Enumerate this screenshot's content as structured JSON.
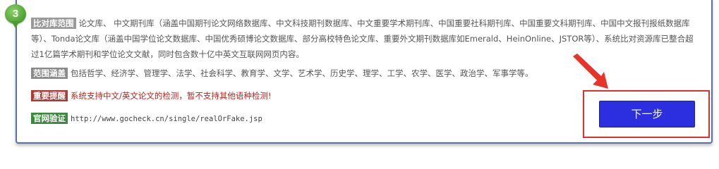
{
  "step": {
    "number": "3"
  },
  "scope": {
    "tag": "比对库范围",
    "text": "论文库、 中文期刊库（涵盖中国期刊论文网络数据库、中文科技期刊数据库、中文重要学术期刊库、中国重要社科期刊库、中国重要文科期刊库、中国中文报刊报纸数据库等）、Tonda论文库（涵盖中国学位论文数据库、中国优秀硕博论文数据库、部分高校特色论文库、重要外文期刊数据库如Emerald、HeinOnline、JSTOR等）、系统比对资源库已整合超过1亿篇学术期刊和学位论文文献，同时包含数十亿中英文互联网网页内容。"
  },
  "coverage": {
    "tag": "范围涵盖",
    "text": "包括哲学、经济学、管理学、法学、社会科学、教育学、文学、艺术学、历史学、理学、工学、农学、医学、政治学、军事学等。"
  },
  "notice": {
    "tag": "重要提醒",
    "text": "系统支持中文/英文论文的检测，暂不支持其他语种检测!"
  },
  "verify": {
    "tag": "官网验证",
    "url": "http://www.gocheck.cn/single/realOrFake.jsp"
  },
  "next_button": {
    "label": "下一步"
  },
  "colors": {
    "button": "#2b2fe0",
    "highlight": "#e0312a",
    "badge": "#54a83a"
  }
}
